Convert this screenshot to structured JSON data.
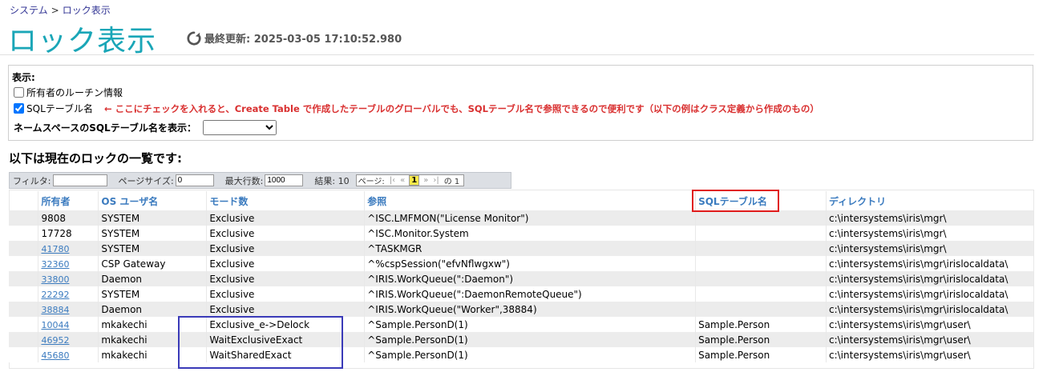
{
  "breadcrumb": {
    "root": "システム",
    "separator": ">",
    "current": "ロック表示"
  },
  "page": {
    "title": "ロック表示",
    "last_update_label": "最終更新: 2025-03-05 17:10:52.980"
  },
  "options": {
    "label": "表示:",
    "owner_routine": {
      "label": "所有者のルーチン情報",
      "checked": false
    },
    "sql_table_name": {
      "label": "SQLテーブル名",
      "checked": true
    },
    "annotation": "← ここにチェックを入れると、Create Table で作成したテーブルのグローバルでも、SQLテーブル名で参照できるので便利です（以下の例はクラス定義から作成のもの）",
    "namespace_label": "ネームスペースのSQLテーブル名を表示：",
    "namespace_value": ""
  },
  "list_heading": "以下は現在のロックの一覧です:",
  "toolbar": {
    "filter_label": "フィルタ:",
    "filter_value": "",
    "page_size_label": "ページサイズ:",
    "page_size_value": "0",
    "max_rows_label": "最大行数:",
    "max_rows_value": "1000",
    "results_label": "結果: 10",
    "pager_label": "ページ:",
    "pager_first": "|‹",
    "pager_prev": "«",
    "pager_current": "1",
    "pager_next": "»",
    "pager_last": "›|",
    "pager_total": "の 1"
  },
  "table": {
    "headers": [
      "所有者",
      "OS ユーザ名",
      "モード数",
      "参照",
      "SQLテーブル名",
      "ディレクトリ"
    ],
    "rows": [
      {
        "owner": "9808",
        "owner_link": false,
        "os_user": "SYSTEM",
        "mode": "Exclusive",
        "ref": "^ISC.LMFMON(\"License Monitor\")",
        "sql_table": "",
        "dir": "c:\\intersystems\\iris\\mgr\\"
      },
      {
        "owner": "17728",
        "owner_link": false,
        "os_user": "SYSTEM",
        "mode": "Exclusive",
        "ref": "^ISC.Monitor.System",
        "sql_table": "",
        "dir": "c:\\intersystems\\iris\\mgr\\"
      },
      {
        "owner": "41780",
        "owner_link": true,
        "os_user": "SYSTEM",
        "mode": "Exclusive",
        "ref": "^TASKMGR",
        "sql_table": "",
        "dir": "c:\\intersystems\\iris\\mgr\\"
      },
      {
        "owner": "32360",
        "owner_link": true,
        "os_user": "CSP Gateway",
        "mode": "Exclusive",
        "ref": "^%cspSession(\"efvNflwgxw\")",
        "sql_table": "",
        "dir": "c:\\intersystems\\iris\\mgr\\irislocaldata\\"
      },
      {
        "owner": "33800",
        "owner_link": true,
        "os_user": "Daemon",
        "mode": "Exclusive",
        "ref": "^IRIS.WorkQueue(\":Daemon\")",
        "sql_table": "",
        "dir": "c:\\intersystems\\iris\\mgr\\irislocaldata\\"
      },
      {
        "owner": "22292",
        "owner_link": true,
        "os_user": "SYSTEM",
        "mode": "Exclusive",
        "ref": "^IRIS.WorkQueue(\":DaemonRemoteQueue\")",
        "sql_table": "",
        "dir": "c:\\intersystems\\iris\\mgr\\irislocaldata\\"
      },
      {
        "owner": "38884",
        "owner_link": true,
        "os_user": "Daemon",
        "mode": "Exclusive",
        "ref": "^IRIS.WorkQueue(\"Worker\",38884)",
        "sql_table": "",
        "dir": "c:\\intersystems\\iris\\mgr\\irislocaldata\\"
      },
      {
        "owner": "10044",
        "owner_link": true,
        "os_user": "mkakechi",
        "mode": "Exclusive_e->Delock",
        "ref": "^Sample.PersonD(1)",
        "sql_table": "Sample.Person",
        "dir": "c:\\intersystems\\iris\\mgr\\user\\"
      },
      {
        "owner": "46952",
        "owner_link": true,
        "os_user": "mkakechi",
        "mode": "WaitExclusiveExact",
        "ref": "^Sample.PersonD(1)",
        "sql_table": "Sample.Person",
        "dir": "c:\\intersystems\\iris\\mgr\\user\\"
      },
      {
        "owner": "45680",
        "owner_link": true,
        "os_user": "mkakechi",
        "mode": "WaitSharedExact",
        "ref": "^Sample.PersonD(1)",
        "sql_table": "Sample.Person",
        "dir": "c:\\intersystems\\iris\\mgr\\user\\"
      }
    ]
  },
  "colors": {
    "title": "#1aa6b7",
    "link": "#3b7bbf",
    "annotation": "#d93030",
    "highlight_sql_column_box": "#e01b1b",
    "highlight_mode_box": "#3a3ab8"
  }
}
